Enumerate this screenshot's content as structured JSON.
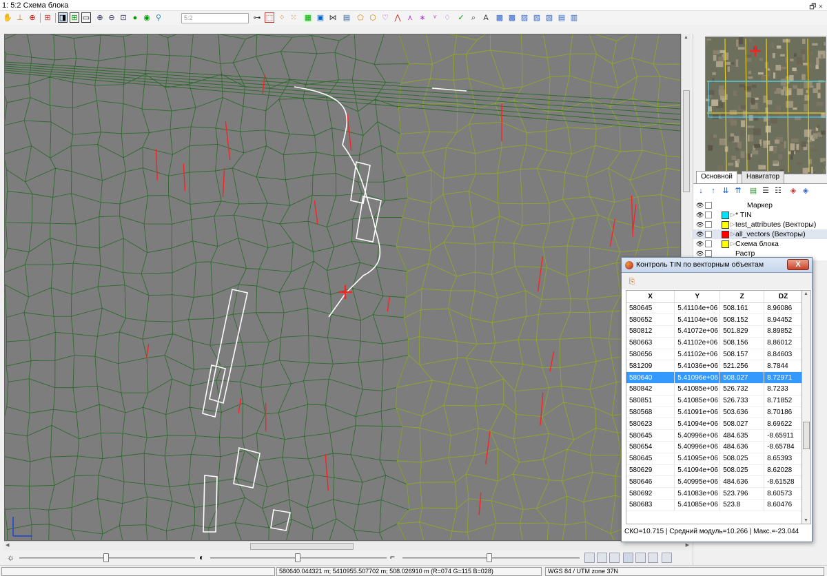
{
  "window": {
    "title": "1: 5:2 Схема блока",
    "controls": "🗗 ×"
  },
  "toolbar": {
    "scale_value": "5:2"
  },
  "colors": {
    "map_bg": "#7d7d7d",
    "tin_dark": "#2e6b2e",
    "tin_light": "#8fa82a",
    "breakline": "#ff2020",
    "vector": "#ffffff",
    "selection": "#3399ff"
  },
  "layers_panel": {
    "tabs": [
      "Основной",
      "Навигатор"
    ],
    "items": [
      {
        "name": "Маркер",
        "color": "",
        "expand": ""
      },
      {
        "name": "* TIN",
        "color": "#00e5ff",
        "expand": "▷"
      },
      {
        "name": "test_attributes (Векторы)",
        "color": "#ffff00",
        "expand": "▷"
      },
      {
        "name": "all_vectors (Векторы)",
        "color": "#ff0000",
        "expand": "▷"
      },
      {
        "name": "Схема блока",
        "color": "#ffff00",
        "expand": "▷"
      },
      {
        "name": "Растр",
        "color": "",
        "expand": ""
      }
    ]
  },
  "dialog": {
    "title": "Контроль TIN по векторным объектам",
    "close": "X",
    "columns": [
      "X",
      "Y",
      "Z",
      "DZ"
    ],
    "rows": [
      [
        "580645",
        "5.41104e+06",
        "508.161",
        "8.96086"
      ],
      [
        "580652",
        "5.41104e+06",
        "508.152",
        "8.94452"
      ],
      [
        "580812",
        "5.41072e+06",
        "501.829",
        "8.89852"
      ],
      [
        "580663",
        "5.41102e+06",
        "508.156",
        "8.86012"
      ],
      [
        "580656",
        "5.41102e+06",
        "508.157",
        "8.84603"
      ],
      [
        "581209",
        "5.41036e+06",
        "521.256",
        "8.7844"
      ],
      [
        "580640",
        "5.41096e+06",
        "508.027",
        "8.72971"
      ],
      [
        "580842",
        "5.41085e+06",
        "526.732",
        "8.7233"
      ],
      [
        "580851",
        "5.41085e+06",
        "526.733",
        "8.71852"
      ],
      [
        "580568",
        "5.41091e+06",
        "503.636",
        "8.70186"
      ],
      [
        "580623",
        "5.41094e+06",
        "508.027",
        "8.69622"
      ],
      [
        "580645",
        "5.40996e+06",
        "484.635",
        "-8.65911"
      ],
      [
        "580654",
        "5.40996e+06",
        "484.636",
        "-8.65784"
      ],
      [
        "580645",
        "5.41095e+06",
        "508.025",
        "8.65393"
      ],
      [
        "580629",
        "5.41094e+06",
        "508.025",
        "8.62028"
      ],
      [
        "580646",
        "5.40995e+06",
        "484.636",
        "-8.61528"
      ],
      [
        "580692",
        "5.41083e+06",
        "523.796",
        "8.60573"
      ],
      [
        "580683",
        "5.41085e+06",
        "523.8",
        "8.60476"
      ]
    ],
    "selected_row_index": 6,
    "status": "СКО=10.715 | Средний модуль=10.266 | Макс.=-23.044"
  },
  "statusbar": {
    "coords": "580640.044321 m; 5410955.507702 m; 508.026910 m   (R=074 G=115 B=028)",
    "crs": "WGS 84 / UTM zone 37N"
  }
}
